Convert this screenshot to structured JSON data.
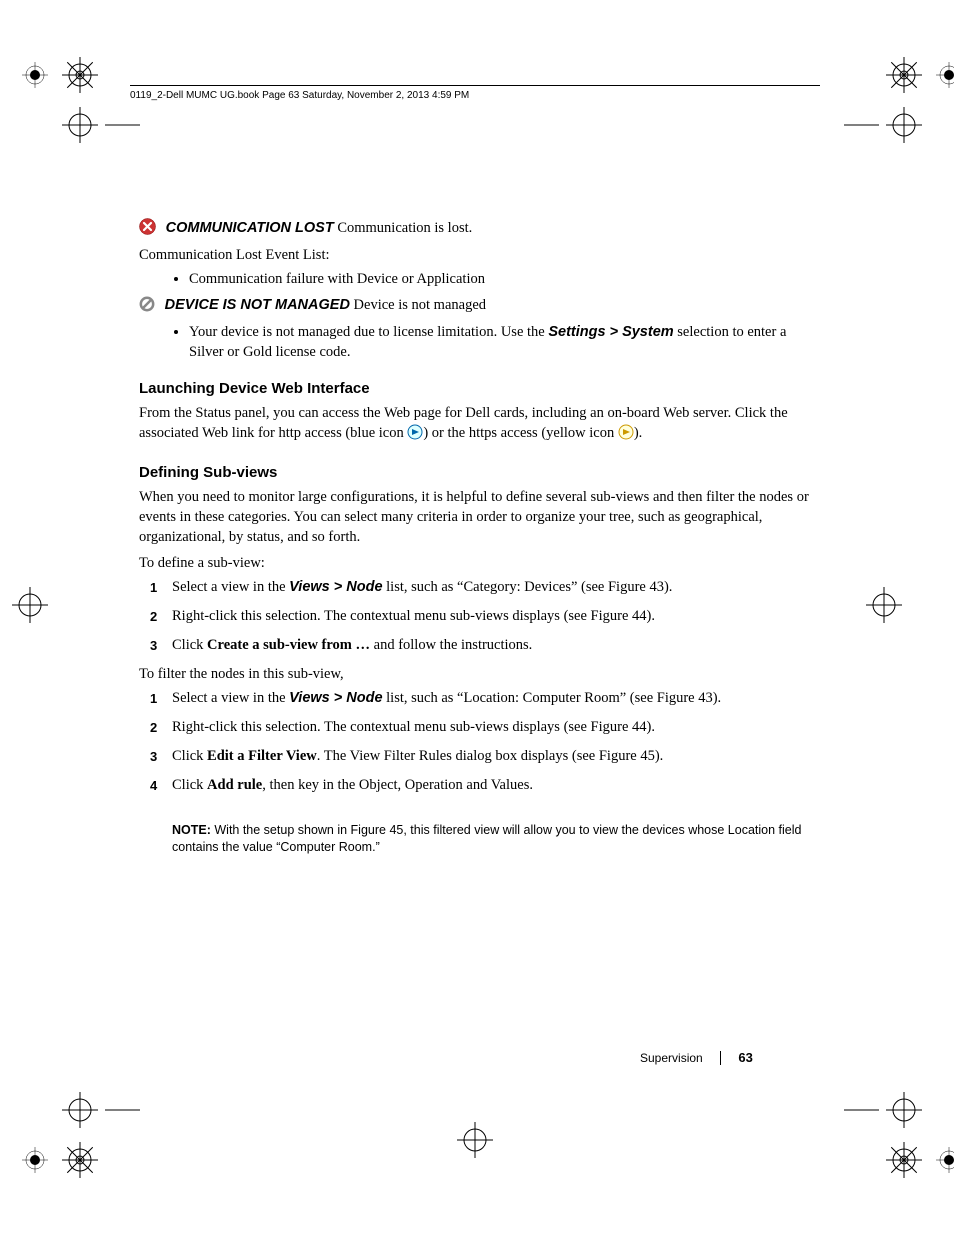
{
  "header": {
    "running": "0119_2-Dell MUMC UG.book  Page 63  Saturday, November 2, 2013  4:59 PM"
  },
  "commLost": {
    "iconName": "error-x-icon",
    "label": "COMMUNICATION LOST",
    "suffix": " Communication is lost.",
    "eventListTitle": "Communication Lost Event List:",
    "bullet1": "Communication failure with Device or Application"
  },
  "notManaged": {
    "iconName": "forbidden-icon",
    "label": "DEVICE IS NOT MANAGED",
    "suffix": " Device is not managed",
    "bulletPrefix": "Your device is not managed due to license limitation. Use the ",
    "menuPath": "Settings > System",
    "bulletSuffix": " selection to enter a Silver or Gold license code."
  },
  "launching": {
    "title": "Launching Device Web Interface",
    "p1a": "From the Status panel, you can access the Web page for Dell cards, including an on-board Web server. Click the associated Web link for http access (blue icon ",
    "p1b": ") or the https access (yellow icon ",
    "p1c": ")."
  },
  "defining": {
    "title": "Defining Sub-views",
    "p1": "When you need to monitor large configurations, it is helpful to define several sub-views and then filter the nodes or events in these categories. You can select many criteria in order to organize your tree, such as geographical, organizational, by status, and so forth.",
    "p2": "To define a sub-view:",
    "list1": {
      "i1a": "Select a view in the ",
      "i1menu": "Views > Node",
      "i1b": " list, such as “Category: Devices” (see Figure 43).",
      "i2": "Right-click this selection. The contextual menu sub-views displays (see Figure 44).",
      "i3a": "Click ",
      "i3bold": "Create a sub-view from …",
      "i3b": " and follow the instructions."
    },
    "p3": "To filter the nodes in this sub-view,",
    "list2": {
      "i1a": "Select a view in the ",
      "i1menu": "Views > Node",
      "i1b": " list, such as “Location: Computer Room” (see Figure 43).",
      "i2": "Right-click this selection. The contextual menu sub-views displays (see Figure 44).",
      "i3a": "Click ",
      "i3bold": "Edit a Filter View",
      "i3b": ". The View Filter Rules dialog box displays (see Figure 45).",
      "i4a": "Click ",
      "i4bold": "Add rule",
      "i4b": ", then key in the Object, Operation and Values."
    }
  },
  "note": {
    "label": "NOTE:",
    "text": " With the setup shown in Figure 45, this filtered view will allow you to view the devices whose Location field contains the value “Computer Room.”"
  },
  "footer": {
    "section": "Supervision",
    "page": "63"
  }
}
